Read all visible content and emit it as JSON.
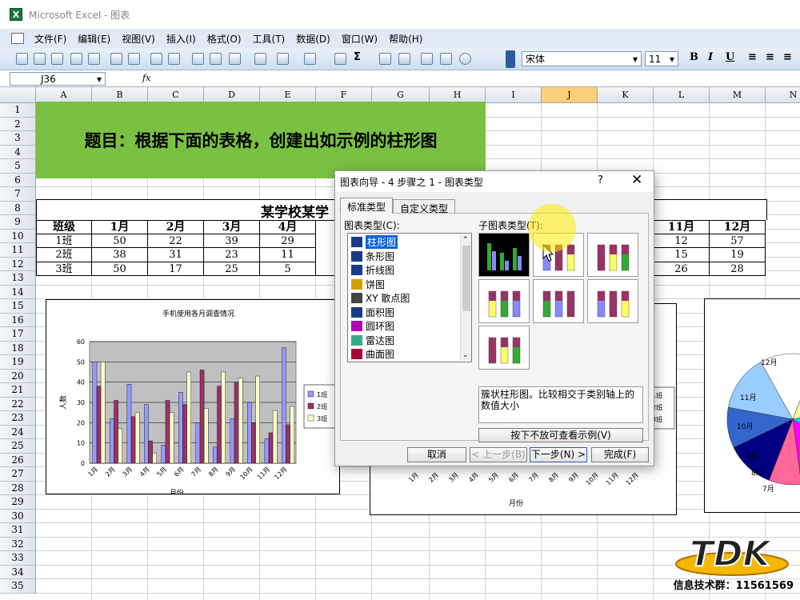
{
  "window": {
    "title": "Microsoft Excel - 图表",
    "icon": "excel-icon"
  },
  "menu": [
    "文件(F)",
    "编辑(E)",
    "视图(V)",
    "插入(I)",
    "格式(O)",
    "工具(T)",
    "数据(D)",
    "窗口(W)",
    "帮助(H)"
  ],
  "toolbar": {
    "font": "宋体",
    "size": "11",
    "bold": "B",
    "italic": "I",
    "underline": "U"
  },
  "formula": {
    "cell_ref": "J36",
    "fx": "fx"
  },
  "columns": [
    "A",
    "B",
    "C",
    "D",
    "E",
    "F",
    "G",
    "H",
    "I",
    "J",
    "K",
    "L",
    "M",
    "N"
  ],
  "rows": [
    "1",
    "2",
    "3",
    "4",
    "5",
    "6",
    "7",
    "8",
    "9",
    "10",
    "11",
    "12",
    "13",
    "14",
    "15",
    "16",
    "17",
    "18",
    "19",
    "20",
    "21",
    "22",
    "23",
    "24",
    "25",
    "26",
    "27",
    "28",
    "29",
    "30",
    "31",
    "32",
    "33",
    "34",
    "35"
  ],
  "title_cell": "题目：根据下面的表格，创建出如示例的柱形图",
  "table": {
    "caption": "某学校某学",
    "headers_left": [
      "班级",
      "1月",
      "2月",
      "3月",
      "4月"
    ],
    "headers_right": [
      "11月",
      "12月"
    ],
    "rows": [
      {
        "cls": "1班",
        "vals": [
          "50",
          "22",
          "39",
          "29"
        ],
        "right": [
          "12",
          "57"
        ]
      },
      {
        "cls": "2班",
        "vals": [
          "38",
          "31",
          "23",
          "11"
        ],
        "right": [
          "15",
          "19"
        ]
      },
      {
        "cls": "3班",
        "vals": [
          "50",
          "17",
          "25",
          "5"
        ],
        "right": [
          "26",
          "28"
        ]
      }
    ]
  },
  "chart_data": [
    {
      "type": "bar",
      "title": "手机使用各月调查情况",
      "xlabel": "月份",
      "ylabel": "人数",
      "ylim": [
        0,
        60
      ],
      "yticks": [
        "0",
        "10",
        "20",
        "30",
        "40",
        "50",
        "60"
      ],
      "categories": [
        "1月",
        "2月",
        "3月",
        "4月",
        "5月",
        "6月",
        "7月",
        "8月",
        "9月",
        "10月",
        "11月",
        "12月"
      ],
      "series": [
        {
          "name": "1班",
          "color": "#9999ff",
          "values": [
            50,
            22,
            39,
            29,
            9,
            35,
            20,
            8,
            22,
            30,
            12,
            57
          ]
        },
        {
          "name": "2班",
          "color": "#993366",
          "values": [
            38,
            31,
            23,
            11,
            31,
            29,
            46,
            38,
            40,
            20,
            15,
            19
          ]
        },
        {
          "name": "3班",
          "color": "#ffffcc",
          "values": [
            50,
            17,
            25,
            5,
            25,
            45,
            27,
            45,
            42,
            43,
            26,
            28
          ]
        }
      ]
    },
    {
      "type": "bar",
      "xlabel": "月份",
      "categories": [
        "1月",
        "2月",
        "3月",
        "4月",
        "5月",
        "6月",
        "7月",
        "8月",
        "9月",
        "10月",
        "11月",
        "12月"
      ],
      "legend": [
        "1班",
        "2班",
        "3班"
      ]
    },
    {
      "type": "pie",
      "labels": [
        "12月",
        "11月",
        "10月",
        "9月",
        "8月",
        "7月"
      ]
    }
  ],
  "dialog": {
    "title": "图表向导 - 4 步骤之 1 - 图表类型",
    "help": "?",
    "close": "✕",
    "tabs": [
      "标准类型",
      "自定义类型"
    ],
    "list_label": "图表类型(C):",
    "sub_label": "子图表类型(T):",
    "types": [
      "柱形图",
      "条形图",
      "折线图",
      "饼图",
      "XY 散点图",
      "面积图",
      "圆环图",
      "雷达图",
      "曲面图"
    ],
    "description": "簇状柱形图。比较相交于类别轴上的数值大小",
    "preview_btn": "按下不放可查看示例(V)",
    "buttons": [
      "取消",
      "< 上一步(B)",
      "下一步(N) >",
      "完成(F)"
    ]
  },
  "status_text": "信息技术群：11561569",
  "logo_text": "TDK"
}
